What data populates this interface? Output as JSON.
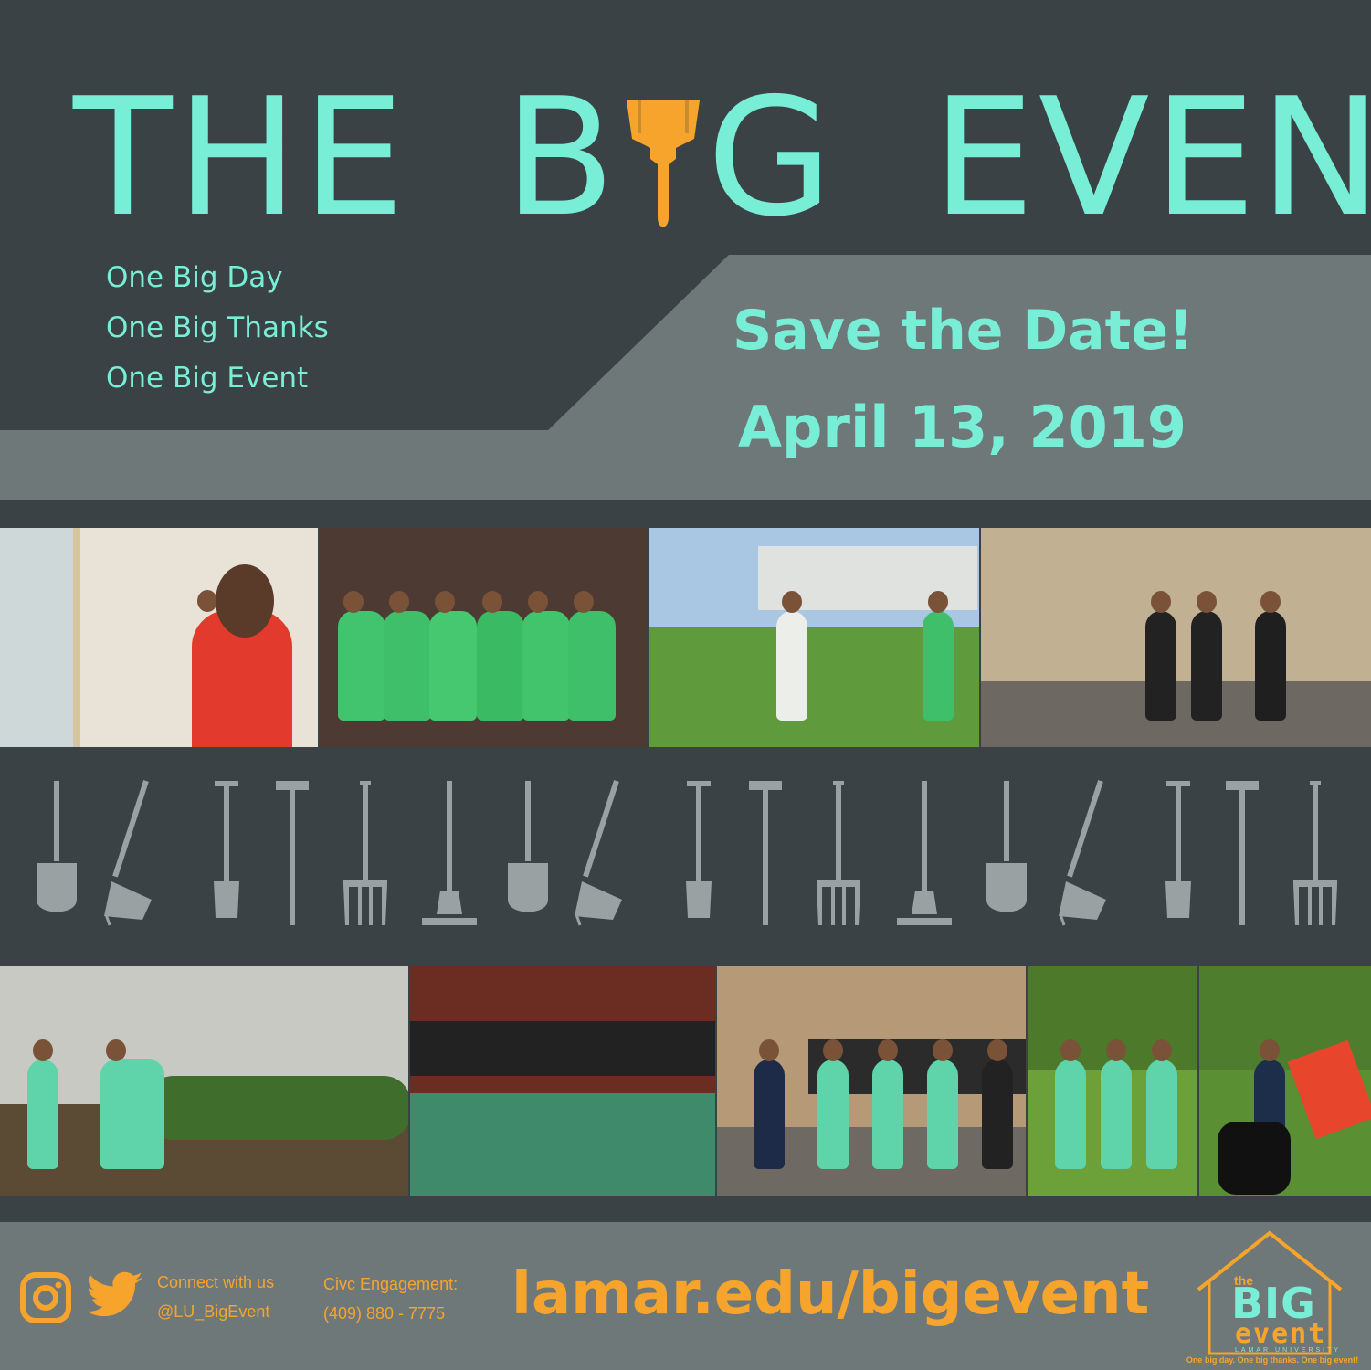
{
  "title": {
    "word1": "THE",
    "b_letter": "B",
    "g_letter": "G",
    "word3": "EVENT"
  },
  "taglines": [
    "One Big Day",
    "One Big Thanks",
    "One Big Event"
  ],
  "save_the_date": "Save the Date!",
  "event_date": "April 13, 2019",
  "social": {
    "connect_label": "Connect with us",
    "handle": "@LU_BigEvent"
  },
  "civic": {
    "label": "Civc Engagement:",
    "phone": "(409) 880 - 7775"
  },
  "website": "lamar.edu/bigevent",
  "logo": {
    "the": "the",
    "big": "BIG",
    "event": "event",
    "university": "LAMAR UNIVERSITY",
    "tagline": "One big day. One big thanks. One big event!"
  },
  "colors": {
    "background": "#3b4245",
    "band": "#6f7879",
    "teal": "#79eed7",
    "orange": "#f7a42c",
    "tool": "#9aa1a2"
  },
  "icons": [
    "paintbrush-icon",
    "instagram-icon",
    "twitter-icon",
    "house-logo-icon",
    "shovel-icon",
    "rake-icon",
    "spade-icon",
    "hammer-icon",
    "pitchfork-icon",
    "hoe-icon"
  ]
}
